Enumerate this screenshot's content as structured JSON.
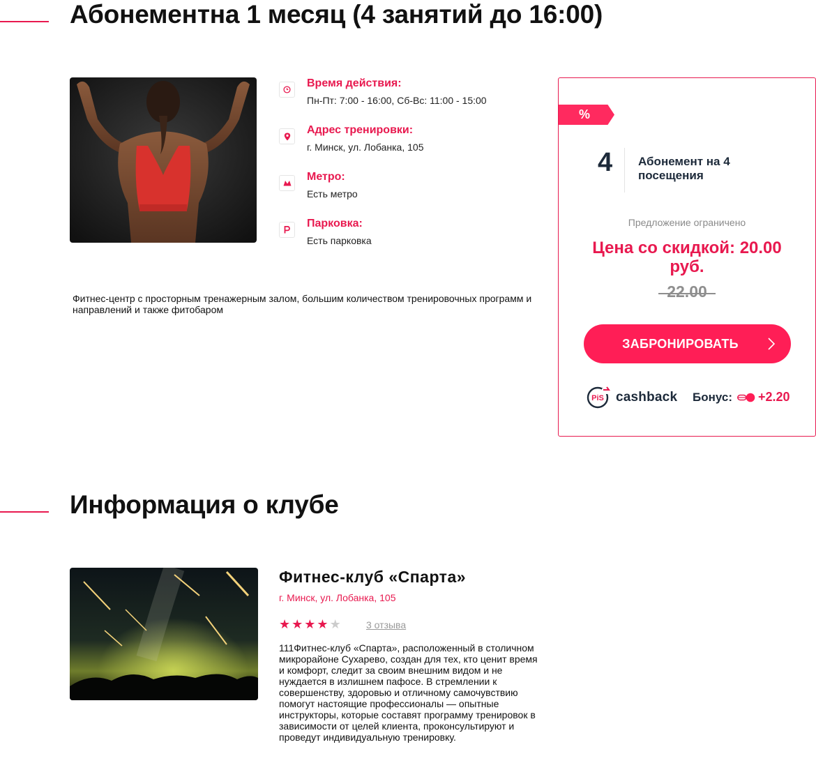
{
  "offer": {
    "title": "Абонементна 1 месяц (4 занятий до 16:00)",
    "description": "Фитнес-центр с просторным тренажерным залом, большим количеством тренировочных программ и направлений и также фитобаром",
    "details": [
      {
        "label": "Время действия:",
        "value": "Пн-Пт: 7:00 - 16:00, Сб-Вс: 11:00 - 15:00",
        "icon": "clock-icon"
      },
      {
        "label": "Адрес тренировки:",
        "value": "г. Минск, ул. Лобанка, 105",
        "icon": "location-pin-icon"
      },
      {
        "label": "Метро:",
        "value": "Есть метро",
        "icon": "metro-icon"
      },
      {
        "label": "Парковка:",
        "value": "Есть парковка",
        "icon": "parking-icon"
      }
    ]
  },
  "card": {
    "discount_badge": "%",
    "visits_number": "4",
    "visits_label": "Абонемент на 4 посещения",
    "limited_note": "Предложение ограничено",
    "price_discount": "Цена со скидкой: 20.00 руб.",
    "price_old": "22.00",
    "book_label": "ЗАБРОНИРОВАТЬ",
    "cashback_logo_text": "PiS",
    "cashback_word": "cashback",
    "bonus_label": "Бонус:",
    "bonus_value": "+2.20"
  },
  "club": {
    "section_title": "Информация о клубе",
    "name": "Фитнес-клуб «Спарта»",
    "address": "г. Минск, ул. Лобанка, 105",
    "rating": 4,
    "rating_max": 5,
    "reviews_link": "3 отзыва",
    "description": "111Фитнес-клуб «Спарта», расположенный в столичном микрорайоне Сухарево, создан для тех, кто ценит время и комфорт, следит за своим внешним видом и не нуждается в излишнем пафосе. В стремлении к совершенству, здоровью и отличному самочувствию помогут настоящие профессионалы — опытные инструкторы, которые составят программу тренировок в зависимости от целей клиента, проконсультируют и проведут индивидуальную тренировку."
  },
  "colors": {
    "accent": "#e8194f",
    "button": "#ff1e56",
    "dark_text": "#1d2a3a"
  }
}
